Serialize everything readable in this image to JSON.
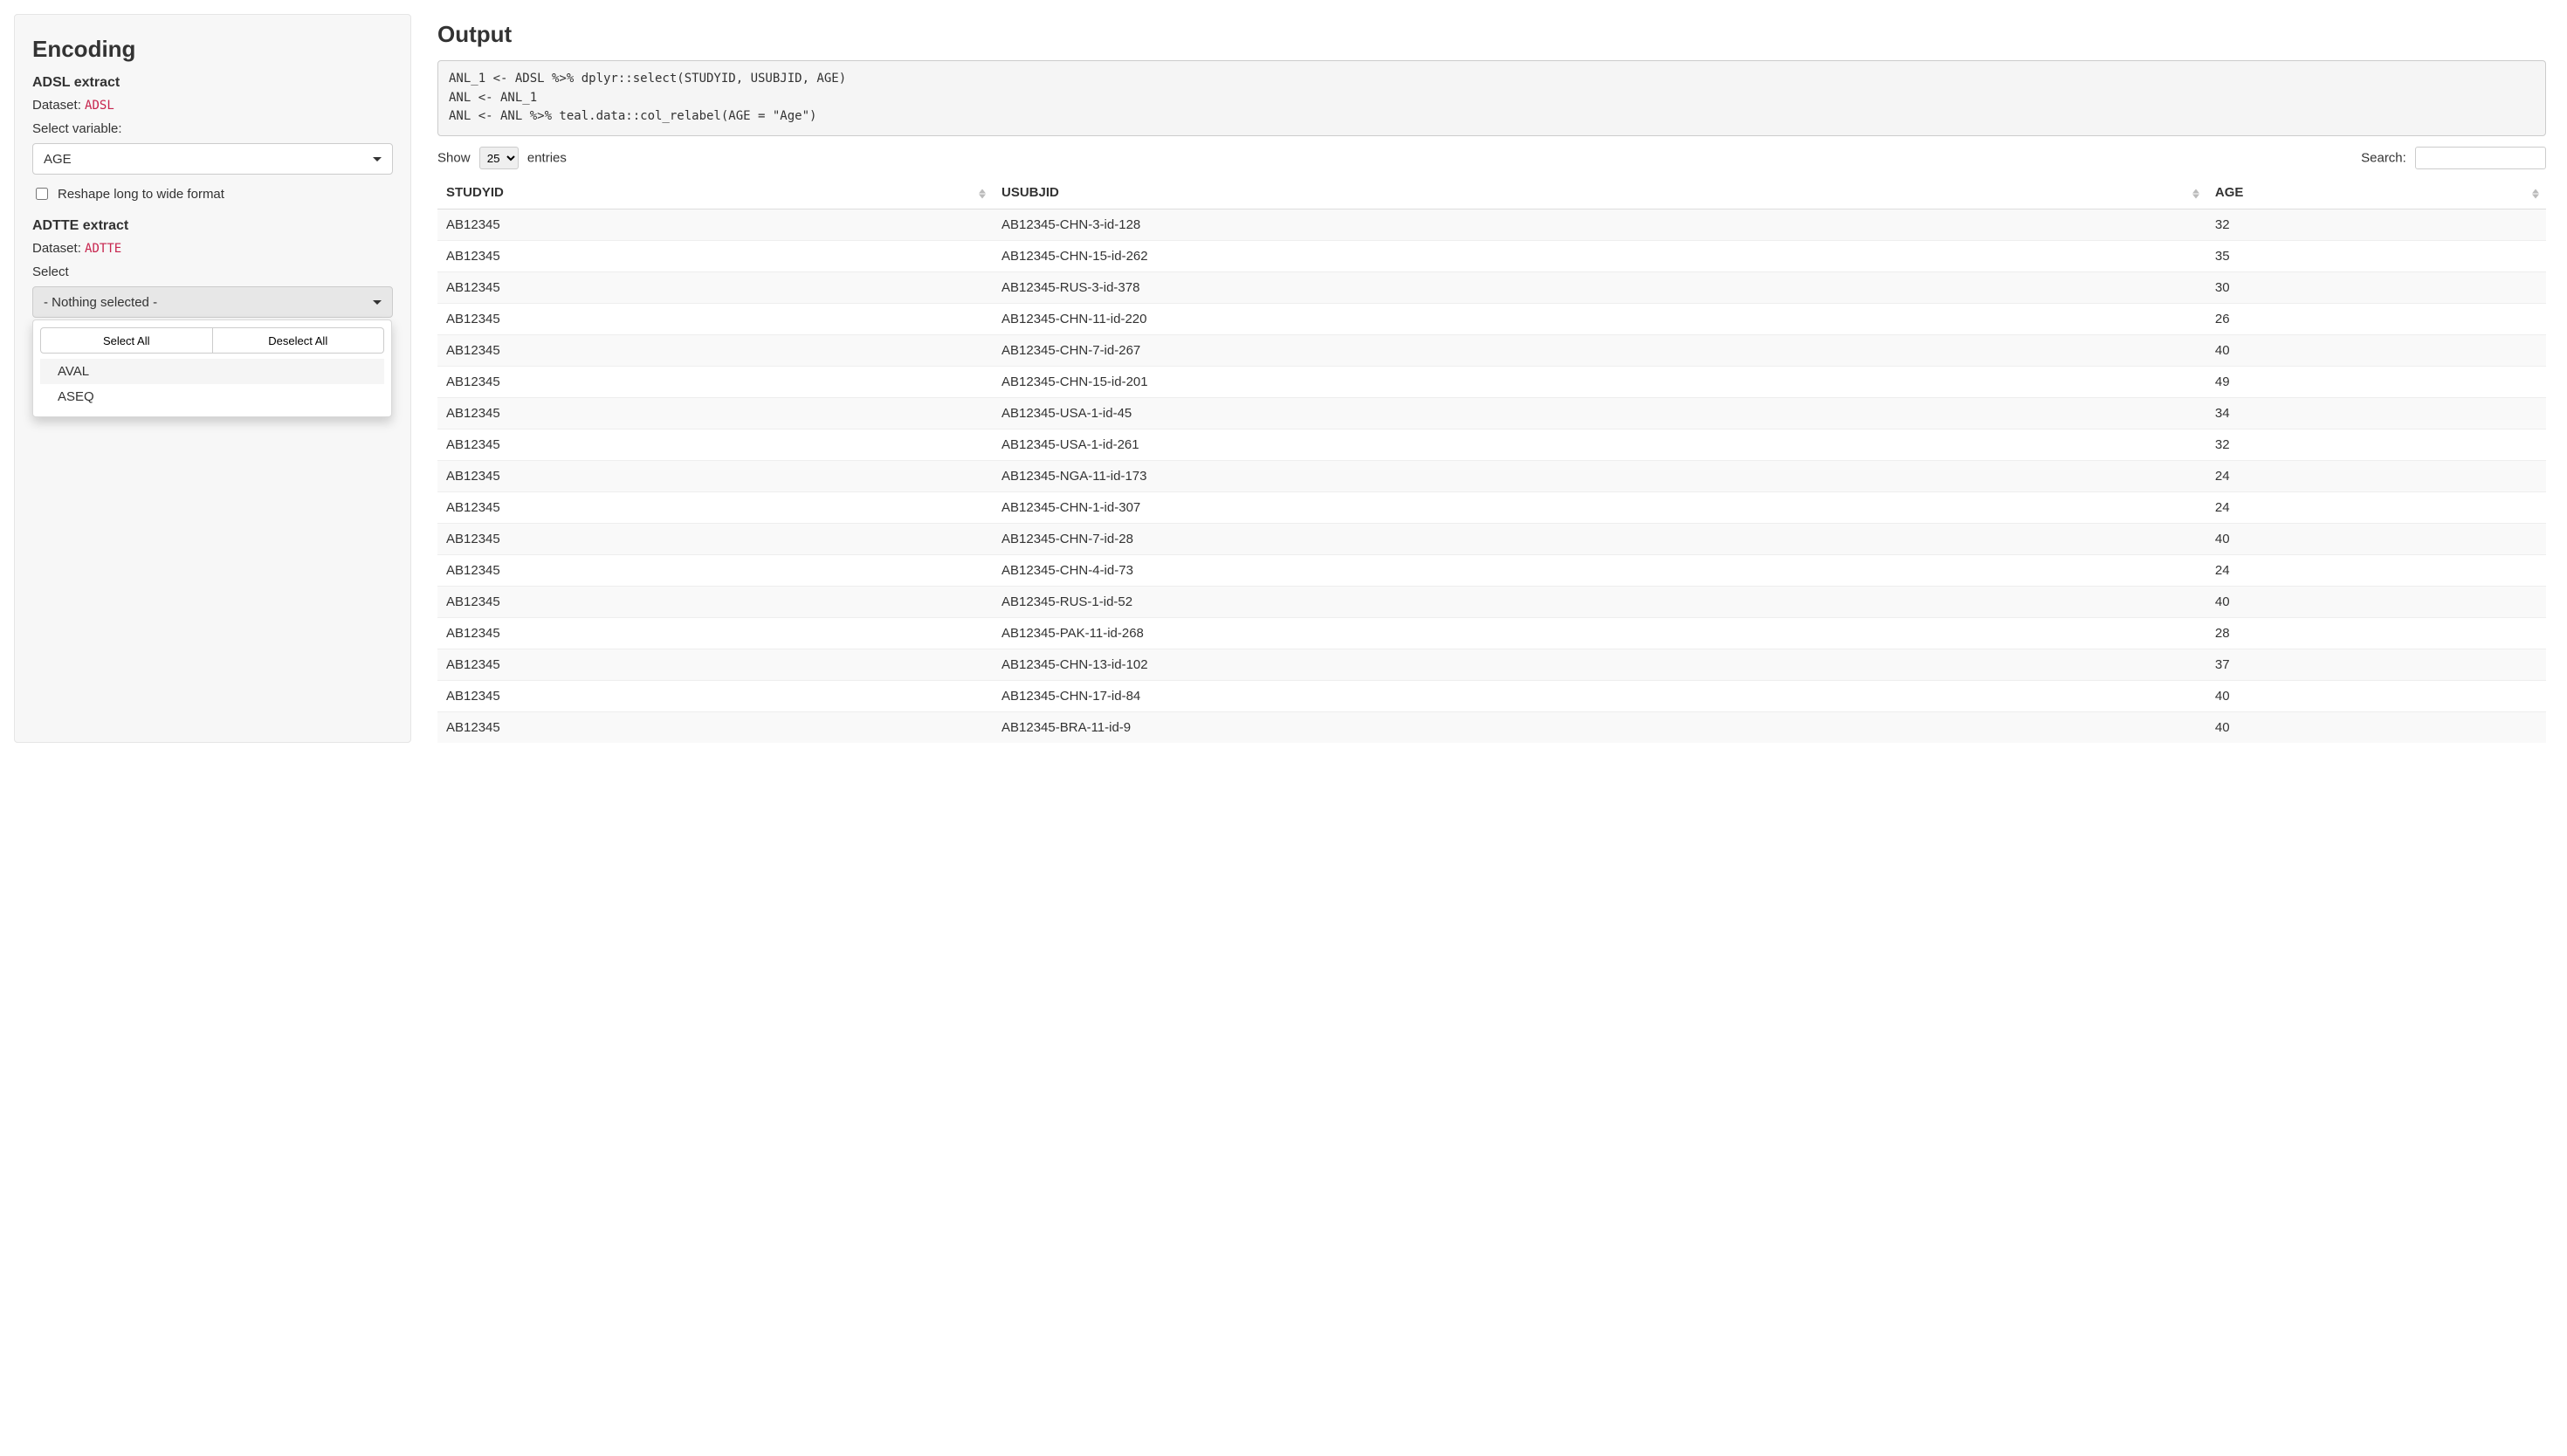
{
  "sidebar": {
    "title": "Encoding",
    "adsl": {
      "section_title": "ADSL extract",
      "dataset_label": "Dataset:",
      "dataset_name": "ADSL",
      "select_label": "Select variable:",
      "select_value": "AGE",
      "reshape_label": "Reshape long to wide format"
    },
    "adtte": {
      "section_title": "ADTTE extract",
      "dataset_label": "Dataset:",
      "dataset_name": "ADTTE",
      "select_label": "Select",
      "select_value": "- Nothing selected -",
      "dropdown": {
        "select_all": "Select All",
        "deselect_all": "Deselect All",
        "options": [
          "AVAL",
          "ASEQ"
        ]
      }
    }
  },
  "output": {
    "title": "Output",
    "code": "ANL_1 <- ADSL %>% dplyr::select(STUDYID, USUBJID, AGE)\nANL <- ANL_1\nANL <- ANL %>% teal.data::col_relabel(AGE = \"Age\")",
    "length_menu": {
      "show": "Show",
      "value": "25",
      "entries": "entries"
    },
    "search": {
      "label": "Search:",
      "value": ""
    },
    "table": {
      "columns": [
        "STUDYID",
        "USUBJID",
        "AGE"
      ],
      "rows": [
        [
          "AB12345",
          "AB12345-CHN-3-id-128",
          "32"
        ],
        [
          "AB12345",
          "AB12345-CHN-15-id-262",
          "35"
        ],
        [
          "AB12345",
          "AB12345-RUS-3-id-378",
          "30"
        ],
        [
          "AB12345",
          "AB12345-CHN-11-id-220",
          "26"
        ],
        [
          "AB12345",
          "AB12345-CHN-7-id-267",
          "40"
        ],
        [
          "AB12345",
          "AB12345-CHN-15-id-201",
          "49"
        ],
        [
          "AB12345",
          "AB12345-USA-1-id-45",
          "34"
        ],
        [
          "AB12345",
          "AB12345-USA-1-id-261",
          "32"
        ],
        [
          "AB12345",
          "AB12345-NGA-11-id-173",
          "24"
        ],
        [
          "AB12345",
          "AB12345-CHN-1-id-307",
          "24"
        ],
        [
          "AB12345",
          "AB12345-CHN-7-id-28",
          "40"
        ],
        [
          "AB12345",
          "AB12345-CHN-4-id-73",
          "24"
        ],
        [
          "AB12345",
          "AB12345-RUS-1-id-52",
          "40"
        ],
        [
          "AB12345",
          "AB12345-PAK-11-id-268",
          "28"
        ],
        [
          "AB12345",
          "AB12345-CHN-13-id-102",
          "37"
        ],
        [
          "AB12345",
          "AB12345-CHN-17-id-84",
          "40"
        ],
        [
          "AB12345",
          "AB12345-BRA-11-id-9",
          "40"
        ]
      ]
    }
  }
}
